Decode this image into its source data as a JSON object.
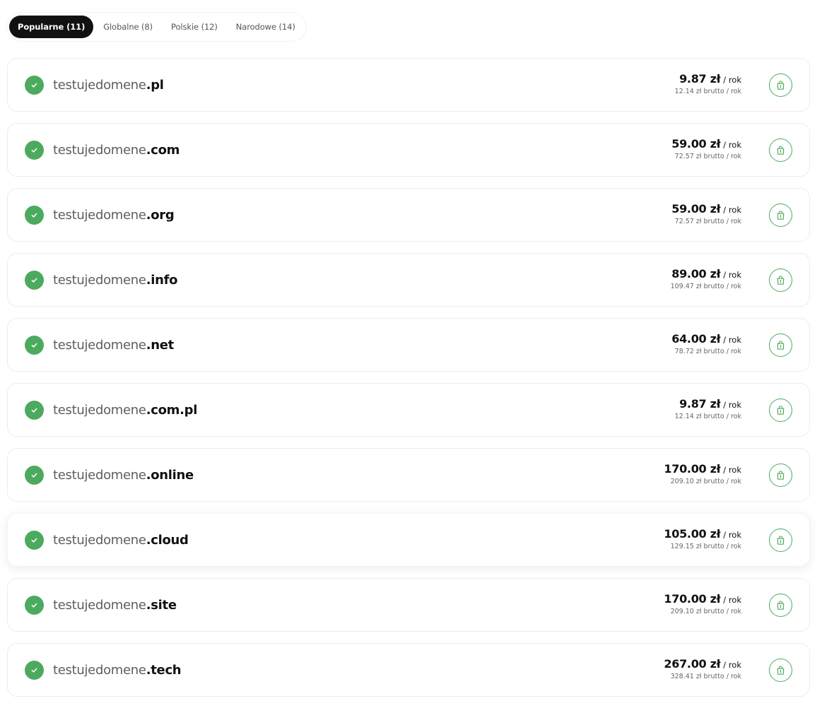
{
  "tabs": [
    {
      "label": "Popularne (11)",
      "active": true
    },
    {
      "label": "Globalne (8)",
      "active": false
    },
    {
      "label": "Polskie (12)",
      "active": false
    },
    {
      "label": "Narodowe (14)",
      "active": false
    }
  ],
  "colors": {
    "accent_green": "#4caa5e",
    "active_tab_bg": "#111111"
  },
  "icons": {
    "status": "check-circle-icon",
    "cart": "shopping-bag-icon"
  },
  "domains": [
    {
      "name": "testujedomene",
      "tld": ".pl",
      "net_price": "9.87 zł",
      "per": "/ rok",
      "gross_price": "12.14 zł brutto / rok",
      "available": true
    },
    {
      "name": "testujedomene",
      "tld": ".com",
      "net_price": "59.00 zł",
      "per": "/ rok",
      "gross_price": "72.57 zł brutto / rok",
      "available": true
    },
    {
      "name": "testujedomene",
      "tld": ".org",
      "net_price": "59.00 zł",
      "per": "/ rok",
      "gross_price": "72.57 zł brutto / rok",
      "available": true
    },
    {
      "name": "testujedomene",
      "tld": ".info",
      "net_price": "89.00 zł",
      "per": "/ rok",
      "gross_price": "109.47 zł brutto / rok",
      "available": true
    },
    {
      "name": "testujedomene",
      "tld": ".net",
      "net_price": "64.00 zł",
      "per": "/ rok",
      "gross_price": "78.72 zł brutto / rok",
      "available": true
    },
    {
      "name": "testujedomene",
      "tld": ".com.pl",
      "net_price": "9.87 zł",
      "per": "/ rok",
      "gross_price": "12.14 zł brutto / rok",
      "available": true
    },
    {
      "name": "testujedomene",
      "tld": ".online",
      "net_price": "170.00 zł",
      "per": "/ rok",
      "gross_price": "209.10 zł brutto / rok",
      "available": true
    },
    {
      "name": "testujedomene",
      "tld": ".cloud",
      "net_price": "105.00 zł",
      "per": "/ rok",
      "gross_price": "129.15 zł brutto / rok",
      "available": true,
      "highlighted": true
    },
    {
      "name": "testujedomene",
      "tld": ".site",
      "net_price": "170.00 zł",
      "per": "/ rok",
      "gross_price": "209.10 zł brutto / rok",
      "available": true
    },
    {
      "name": "testujedomene",
      "tld": ".tech",
      "net_price": "267.00 zł",
      "per": "/ rok",
      "gross_price": "328.41 zł brutto / rok",
      "available": true
    }
  ]
}
